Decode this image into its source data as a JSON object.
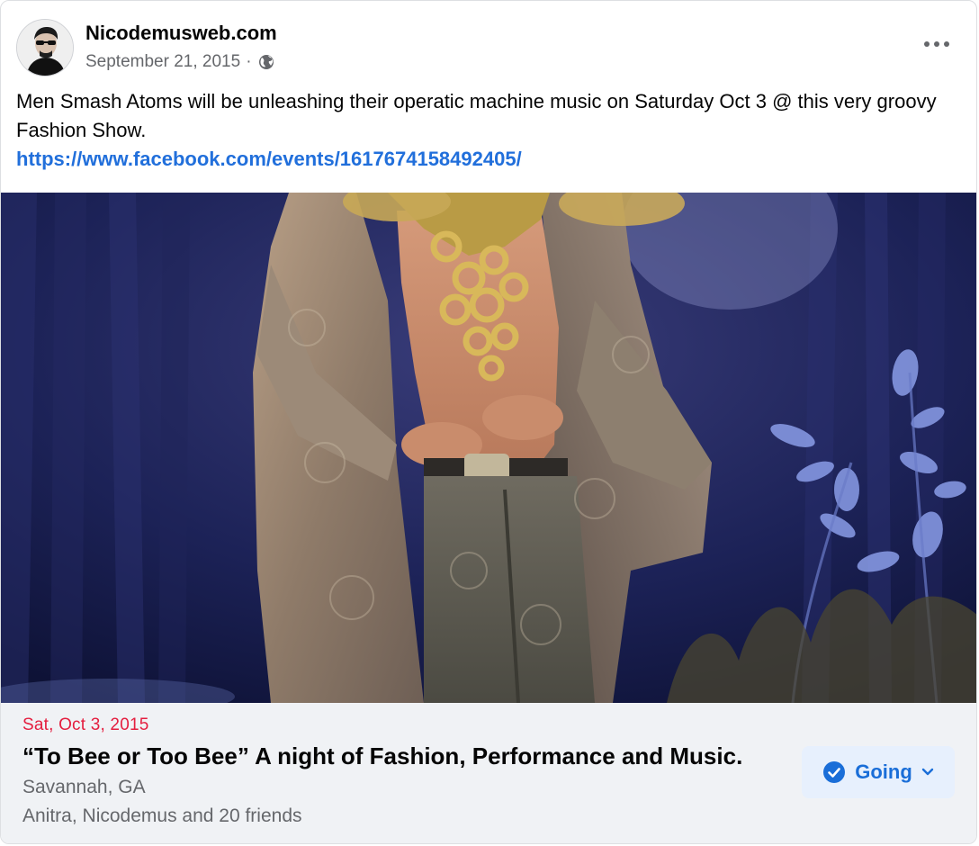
{
  "post": {
    "page_name": "Nicodemusweb.com",
    "date": "September 21, 2015",
    "separator": "·",
    "audience_icon": "globe-icon",
    "text": "Men Smash Atoms will be unleashing their operatic machine music on Saturday Oct 3 @ this very groovy Fashion Show.",
    "link": "https://www.facebook.com/events/1617674158492405/"
  },
  "event": {
    "date": "Sat, Oct 3, 2015",
    "title": "“To Bee or Too Bee” A night of Fashion, Performance and Music.",
    "location": "Savannah, GA",
    "friends": "Anitra, Nicodemus and 20 friends",
    "rsvp_label": "Going"
  },
  "colors": {
    "link": "#216fdb",
    "event_date": "#e41e3f",
    "going_bg": "#e7f0fd",
    "going_fg": "#1a6ed8"
  }
}
